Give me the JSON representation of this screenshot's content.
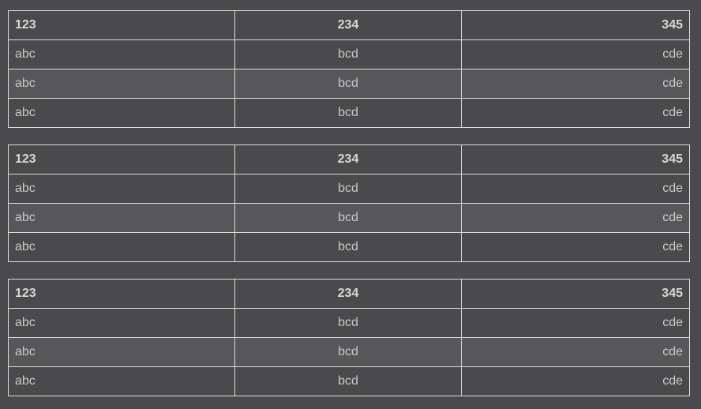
{
  "tables": [
    {
      "header": [
        "123",
        "234",
        "345"
      ],
      "rows": [
        [
          "abc",
          "bcd",
          "cde"
        ],
        [
          "abc",
          "bcd",
          "cde"
        ],
        [
          "abc",
          "bcd",
          "cde"
        ]
      ]
    },
    {
      "header": [
        "123",
        "234",
        "345"
      ],
      "rows": [
        [
          "abc",
          "bcd",
          "cde"
        ],
        [
          "abc",
          "bcd",
          "cde"
        ],
        [
          "abc",
          "bcd",
          "cde"
        ]
      ]
    },
    {
      "header": [
        "123",
        "234",
        "345"
      ],
      "rows": [
        [
          "abc",
          "bcd",
          "cde"
        ],
        [
          "abc",
          "bcd",
          "cde"
        ],
        [
          "abc",
          "bcd",
          "cde"
        ]
      ]
    }
  ],
  "colors": {
    "background": "#4a494b",
    "row_alt": "#575659",
    "border": "#dcdcdc",
    "text": "#c9c9c9"
  }
}
